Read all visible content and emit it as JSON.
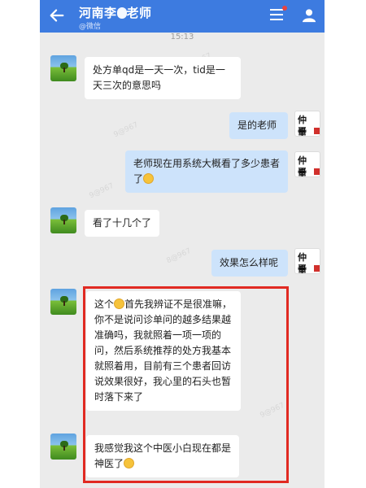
{
  "header": {
    "back_icon": "back-arrow-icon",
    "title_prefix": "河南李",
    "title_suffix": "老师",
    "subtitle": "@微信",
    "menu_icon": "menu-icon",
    "profile_icon": "person-icon",
    "color": "#3d7be0"
  },
  "timestamp": "15:13",
  "messages": [
    {
      "side": "left",
      "text": "处方单qd是一天一次，tid是一天三次的意思吗"
    },
    {
      "side": "right",
      "text": "是的老师"
    },
    {
      "side": "right",
      "text": "老师现在用系统大概看了多少患者了"
    },
    {
      "side": "left",
      "text": "看了十几个了"
    },
    {
      "side": "right",
      "text": "效果怎么样呢"
    },
    {
      "side": "left",
      "text_a": "这个",
      "text_b": "首先我辨证不是很准嘛，你不是说问诊单问的越多结果越准确吗，我就照着一项一项的问，然后系统推荐的处方我基本就照着用，目前有三个患者回访说效果很好，我心里的石头也暂时落下来了"
    },
    {
      "side": "left",
      "text": "我感觉我这个中医小白现在都是神医了"
    }
  ],
  "right_avatar": {
    "line1": "仲 重",
    "line2": "平 仁"
  },
  "highlight_color": "#e12a22"
}
